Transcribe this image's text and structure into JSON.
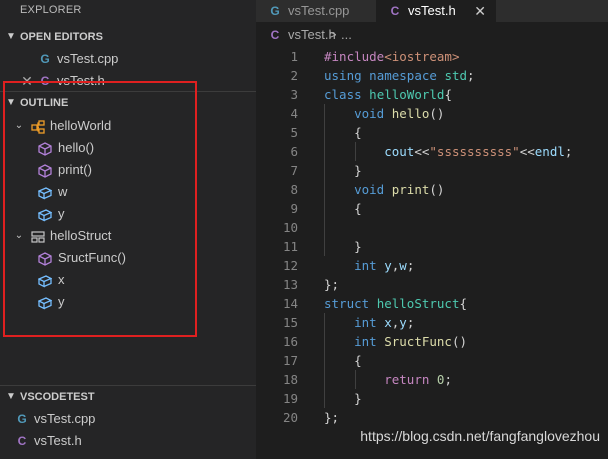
{
  "sidebar": {
    "title": "EXPLORER",
    "open_editors": {
      "header": "OPEN EDITORS",
      "files": [
        {
          "name": "vsTest.cpp",
          "icon": "cpp-file-icon",
          "icon_glyph": "G"
        },
        {
          "name": "vsTest.h",
          "icon": "c-header-file-icon",
          "icon_glyph": "C"
        }
      ]
    },
    "outline": {
      "header": "OUTLINE",
      "items": [
        {
          "label": "helloWorld",
          "icon": "class-icon",
          "expanded": true
        },
        {
          "label": "hello()",
          "icon": "method-icon"
        },
        {
          "label": "print()",
          "icon": "method-icon"
        },
        {
          "label": "w",
          "icon": "field-icon"
        },
        {
          "label": "y",
          "icon": "field-icon"
        },
        {
          "label": "helloStruct",
          "icon": "struct-icon",
          "expanded": true
        },
        {
          "label": "SructFunc()",
          "icon": "method-icon"
        },
        {
          "label": "x",
          "icon": "field-icon"
        },
        {
          "label": "y",
          "icon": "field-icon"
        }
      ],
      "highlight_color": "#e02020"
    },
    "workspace": {
      "header": "VSCODETEST",
      "files": [
        {
          "name": "vsTest.cpp",
          "icon": "cpp-file-icon",
          "icon_glyph": "G"
        },
        {
          "name": "vsTest.h",
          "icon": "c-header-file-icon",
          "icon_glyph": "C"
        }
      ]
    }
  },
  "tabs": [
    {
      "label": "vsTest.cpp",
      "active": false,
      "icon_glyph": "G"
    },
    {
      "label": "vsTest.h",
      "active": true,
      "icon_glyph": "C",
      "close": "✕"
    }
  ],
  "breadcrumb": {
    "file": "vsTest.h",
    "separator": ">",
    "symbol": "..."
  },
  "code": {
    "line_numbers": [
      "1",
      "2",
      "3",
      "4",
      "5",
      "6",
      "7",
      "8",
      "9",
      "10",
      "11",
      "12",
      "13",
      "14",
      "15",
      "16",
      "17",
      "18",
      "19",
      "20"
    ],
    "lines": [
      "#include<iostream>",
      "using namespace std;",
      "class helloWorld{",
      "    void hello()",
      "    {",
      "        cout<<\"ssssssssss\"<<endl;",
      "    }",
      "    void print()",
      "    {",
      "",
      "    }",
      "    int y,w;",
      "};",
      "struct helloStruct{",
      "    int x,y;",
      "    int SructFunc()",
      "    {",
      "        return 0;",
      "    }",
      "};"
    ]
  },
  "watermark": "https://blog.csdn.net/fangfanglovezhou",
  "colors": {
    "sidebar_bg": "#252526",
    "editor_bg": "#1e1e1e",
    "keyword": "#569cd6",
    "type": "#4ec9b0",
    "function": "#dcdcaa",
    "string": "#ce9178",
    "icon_purple": "#b180d7",
    "icon_blue": "#75beff",
    "icon_orange": "#ee9d28"
  }
}
